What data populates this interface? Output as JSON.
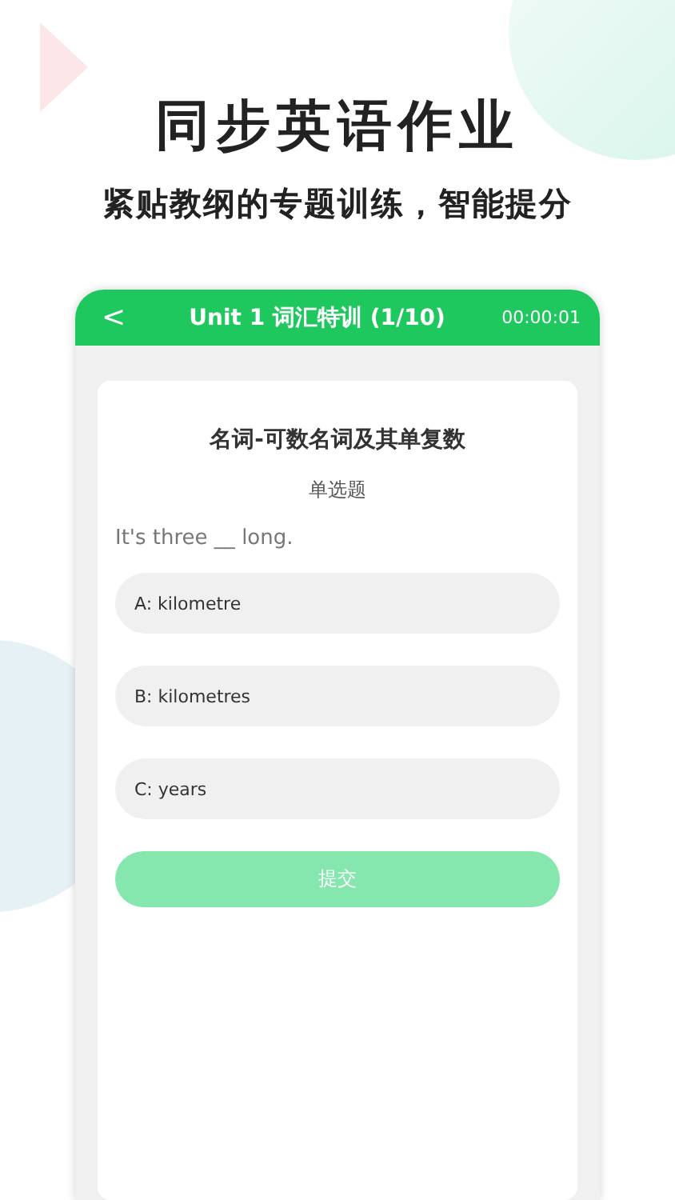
{
  "headline": "同步英语作业",
  "subheadline": "紧贴教纲的专题训练，智能提分",
  "header": {
    "back": "<",
    "title": "Unit 1 词汇特训 (1/10)",
    "timer": "00:00:01"
  },
  "topic": "名词-可数名词及其单复数",
  "question_type": "单选题",
  "question": "It's three __ long.",
  "options": [
    {
      "label": "A: kilometre",
      "selected": false
    },
    {
      "label": "B: kilometres",
      "selected": false
    },
    {
      "label": "C: years",
      "selected": false
    }
  ],
  "submit": {
    "label": "提交",
    "disabled": true
  }
}
